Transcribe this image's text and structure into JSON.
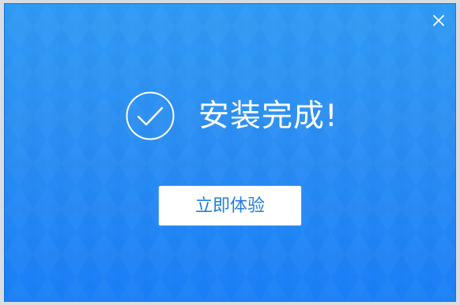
{
  "window": {
    "title": "安装完成!",
    "close_icon": "close-icon",
    "success_icon": "check-circle-icon",
    "primary_button_label": "立即体验",
    "colors": {
      "background_top": "#2f9af4",
      "background_bottom": "#1a7ff7",
      "button_background": "#ffffff",
      "button_text": "#1f7ee3",
      "icon_and_title": "#ffffff"
    }
  }
}
